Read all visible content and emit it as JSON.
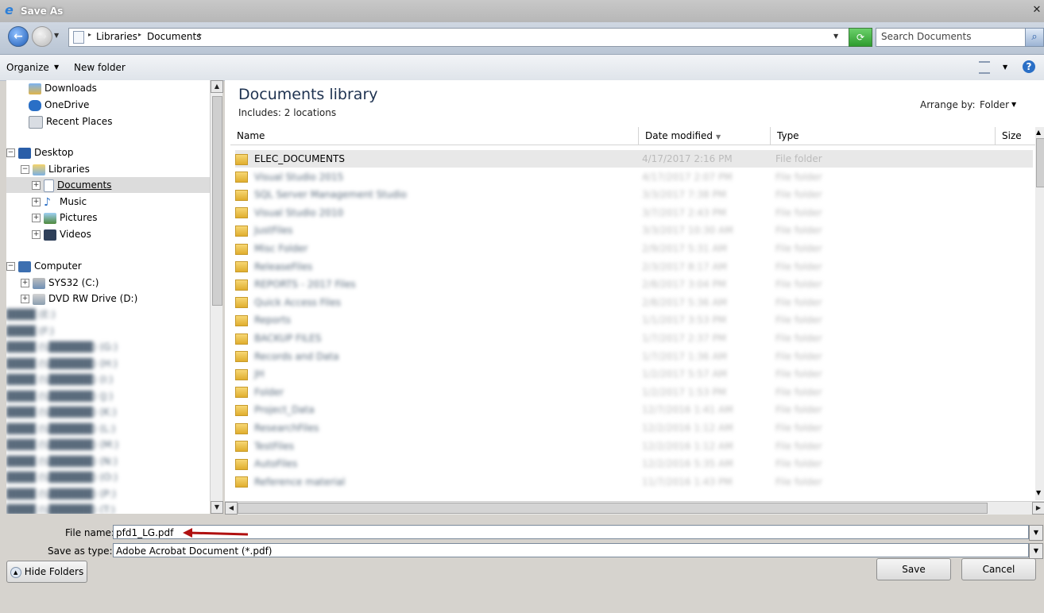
{
  "window": {
    "title": "Save As"
  },
  "nav": {
    "breadcrumb": [
      "Libraries",
      "Documents"
    ],
    "search_placeholder": "Search Documents"
  },
  "toolbar": {
    "organize": "Organize",
    "new_folder": "New folder"
  },
  "left_pane": {
    "favorites": [
      "Downloads",
      "OneDrive",
      "Recent Places"
    ],
    "desktop": "Desktop",
    "libraries": "Libraries",
    "library_items": [
      "Documents",
      "Music",
      "Pictures",
      "Videos"
    ],
    "computer": "Computer",
    "drives": [
      "SYS32 (C:)",
      "DVD RW Drive (D:)"
    ],
    "blurred_items": [
      "████ (E:)",
      "████ (F:)",
      "████ (\\\\██████) (G:)",
      "████ (\\\\██████) (H:)",
      "████ (\\\\██████) (I:)",
      "████ (\\\\██████) (J:)",
      "████ (\\\\██████) (K:)",
      "████ (\\\\██████) (L:)",
      "████ (\\\\██████) (M:)",
      "████ (\\\\██████) (N:)",
      "████ (\\\\██████) (O:)",
      "████ (\\\\██████) (P:)",
      "████ (\\\\██████) (T:)",
      "████ (U:)"
    ]
  },
  "library": {
    "title": "Documents library",
    "subtitle": "Includes: 2 locations",
    "arrange_label": "Arrange by:",
    "arrange_value": "Folder"
  },
  "columns": [
    "Name",
    "Date modified",
    "Type",
    "Size"
  ],
  "files": [
    {
      "name": "ELEC_DOCUMENTS",
      "date": "4/17/2017 2:16 PM",
      "type": "File folder",
      "selected": true
    },
    {
      "name": "Visual Studio 2015",
      "date": "4/17/2017 2:07 PM",
      "type": "File folder",
      "blurred": true
    },
    {
      "name": "SQL Server Management Studio",
      "date": "3/3/2017 7:38 PM",
      "type": "File folder",
      "blurred": true
    },
    {
      "name": "Visual Studio 2010",
      "date": "3/7/2017 2:43 PM",
      "type": "File folder",
      "blurred": true
    },
    {
      "name": "JustFiles",
      "date": "3/3/2017 10:30 AM",
      "type": "File folder",
      "blurred": true
    },
    {
      "name": "Misc Folder",
      "date": "2/9/2017 5:31 AM",
      "type": "File folder",
      "blurred": true
    },
    {
      "name": "ReleaseFiles",
      "date": "2/3/2017 8:17 AM",
      "type": "File folder",
      "blurred": true
    },
    {
      "name": "REPORTS - 2017 Files",
      "date": "2/8/2017 3:04 PM",
      "type": "File folder",
      "blurred": true
    },
    {
      "name": "Quick Access Files",
      "date": "2/8/2017 5:36 AM",
      "type": "File folder",
      "blurred": true
    },
    {
      "name": "Reports",
      "date": "1/1/2017 3:53 PM",
      "type": "File folder",
      "blurred": true
    },
    {
      "name": "BACKUP FILES",
      "date": "1/7/2017 2:37 PM",
      "type": "File folder",
      "blurred": true
    },
    {
      "name": "Records and Data",
      "date": "1/7/2017 1:36 AM",
      "type": "File folder",
      "blurred": true
    },
    {
      "name": "JH",
      "date": "1/2/2017 5:57 AM",
      "type": "File folder",
      "blurred": true
    },
    {
      "name": "Folder",
      "date": "1/2/2017 1:53 PM",
      "type": "File folder",
      "blurred": true
    },
    {
      "name": "Project_Data",
      "date": "12/7/2016 1:41 AM",
      "type": "File folder",
      "blurred": true
    },
    {
      "name": "ResearchFiles",
      "date": "12/2/2016 1:12 AM",
      "type": "File folder",
      "blurred": true
    },
    {
      "name": "TestFiles",
      "date": "12/2/2016 1:12 AM",
      "type": "File folder",
      "blurred": true
    },
    {
      "name": "AutoFiles",
      "date": "12/2/2016 5:35 AM",
      "type": "File folder",
      "blurred": true
    },
    {
      "name": "Reference material",
      "date": "11/7/2016 1:43 PM",
      "type": "File folder",
      "blurred": true
    }
  ],
  "bottom": {
    "file_name_label": "File name:",
    "file_name_value": "pfd1_LG.pdf",
    "save_type_label": "Save as type:",
    "save_type_value": "Adobe Acrobat Document (*.pdf)",
    "hide_folders": "Hide Folders",
    "save": "Save",
    "cancel": "Cancel"
  },
  "colors": {
    "arrow": "#b01010",
    "selected_row": "#e8e8e8",
    "accent": "#1e5aa8"
  }
}
